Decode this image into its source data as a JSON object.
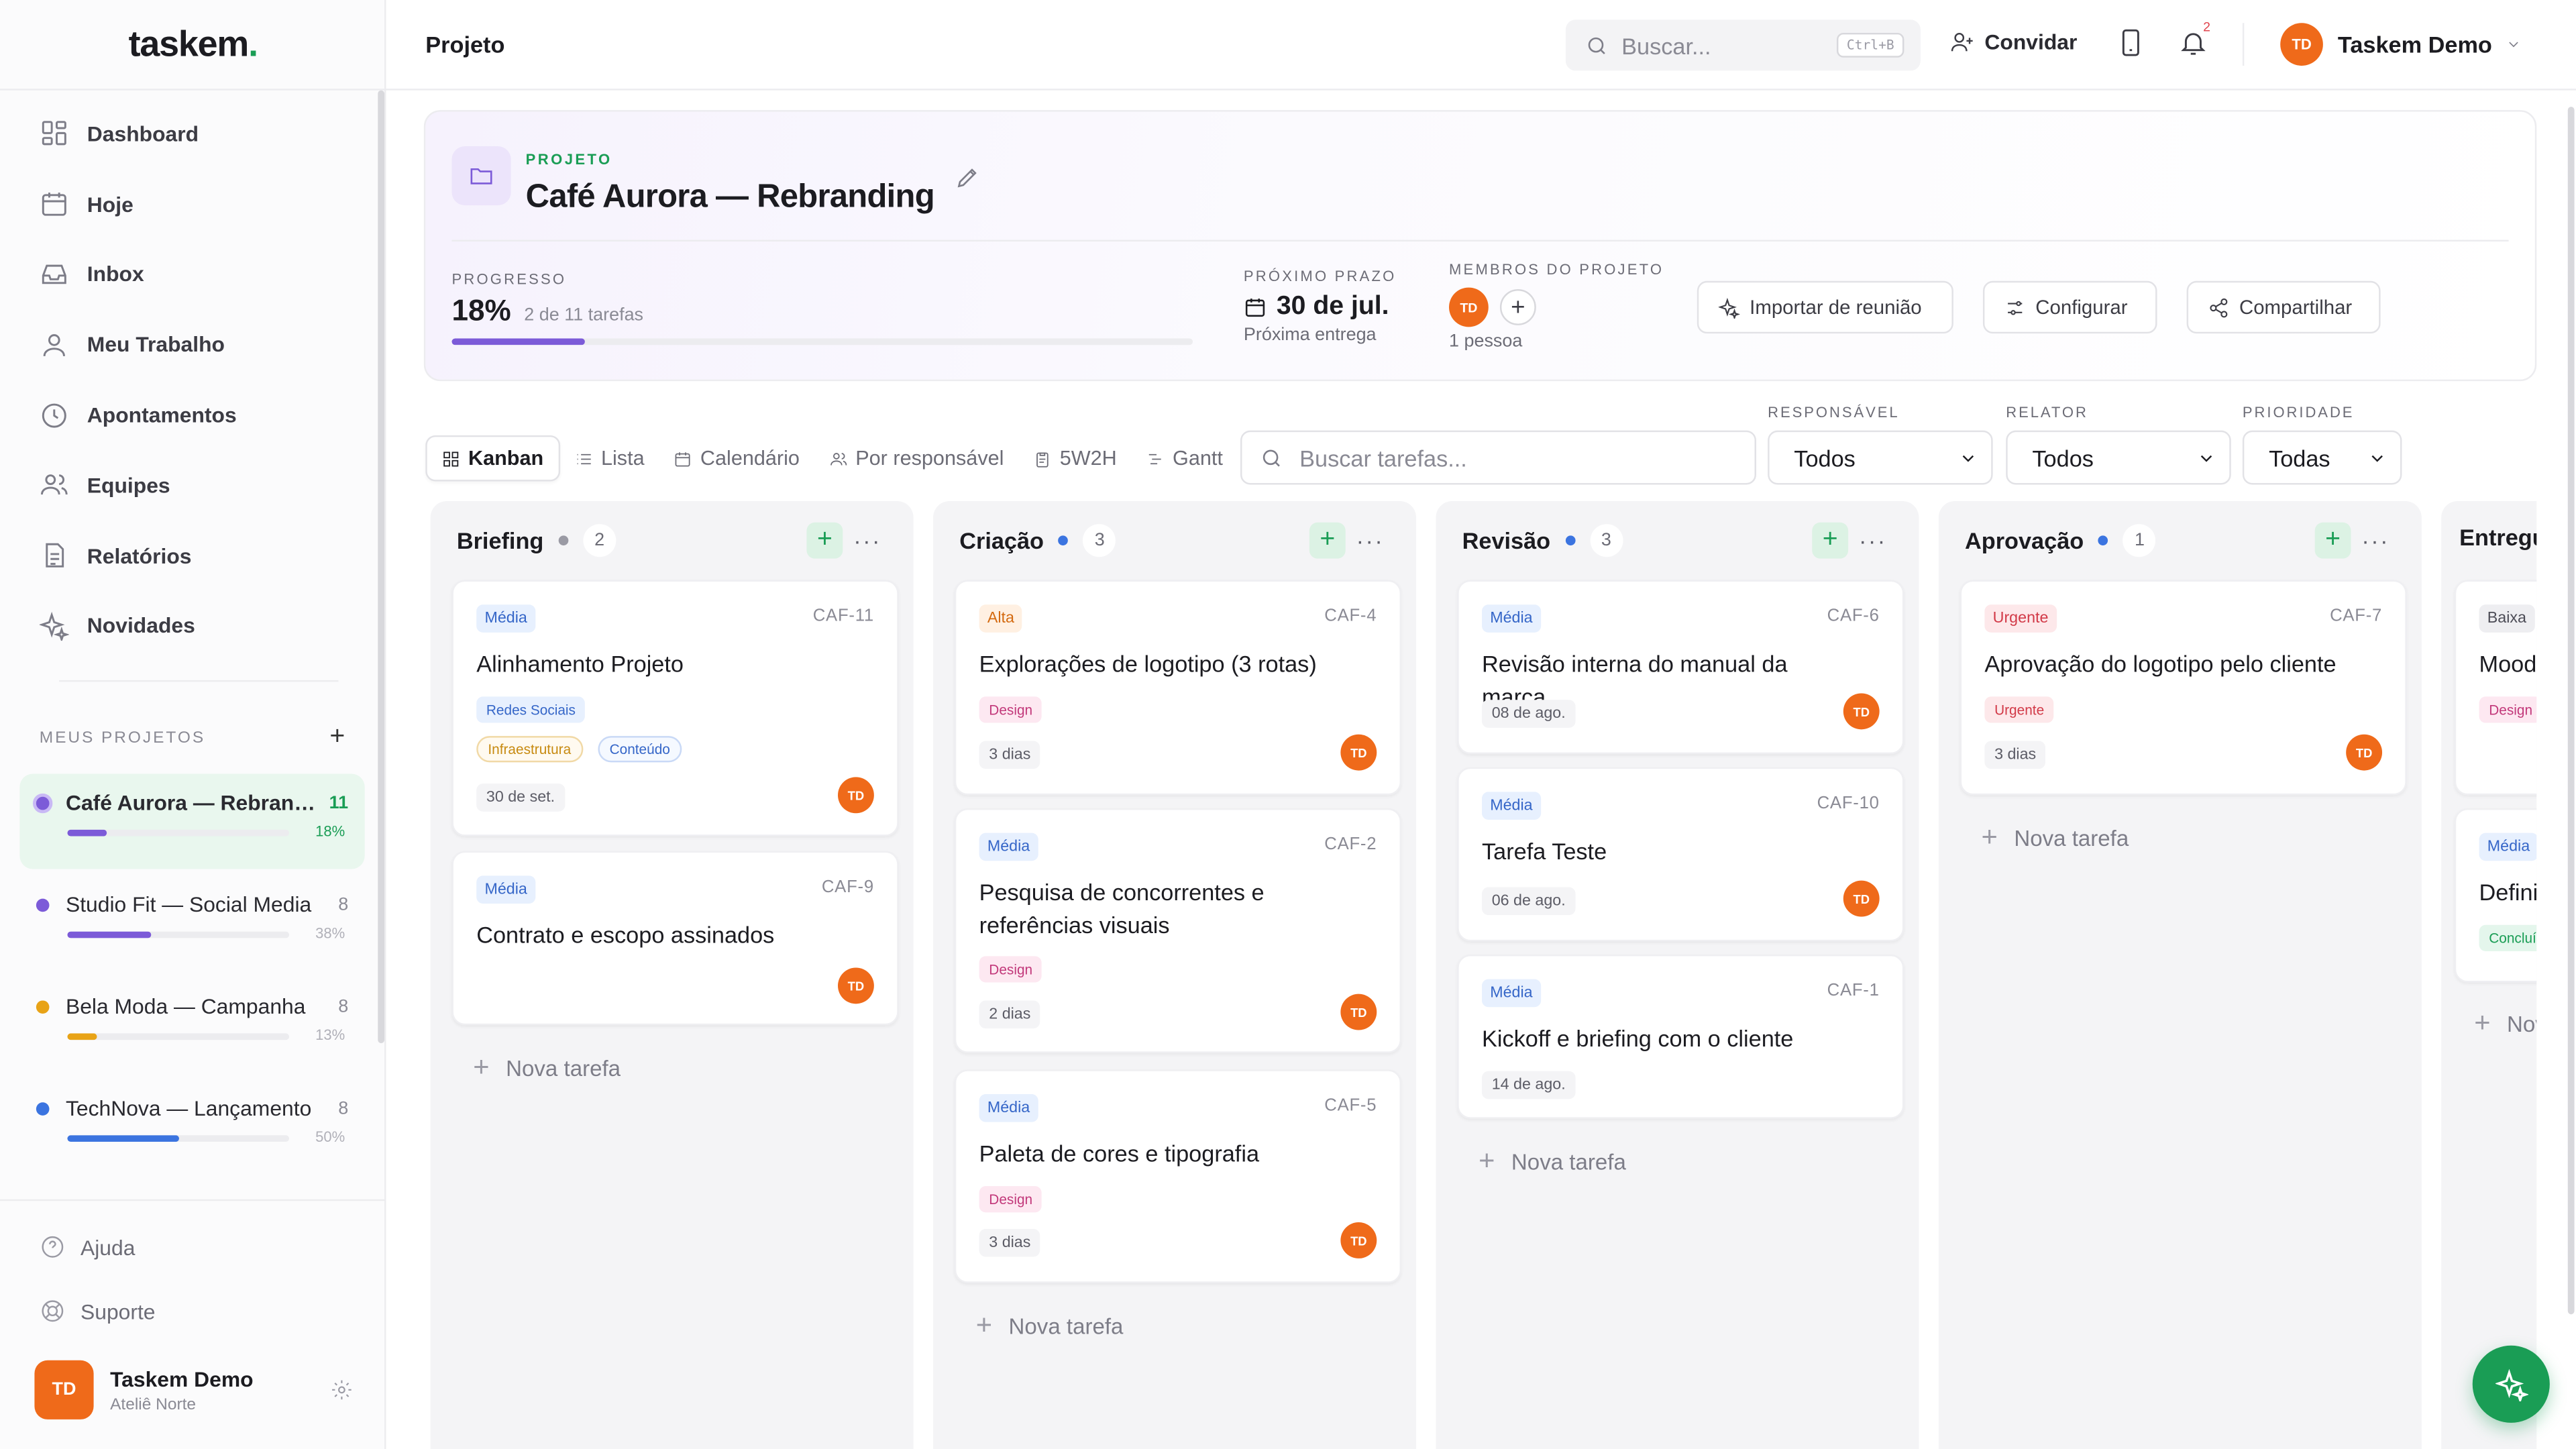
{
  "sidebar": {
    "logo": "taskem",
    "logo_dot": ".",
    "nav": [
      {
        "label": "Dashboard",
        "icon": "dashboard-icon"
      },
      {
        "label": "Hoje",
        "icon": "calendar-icon"
      },
      {
        "label": "Inbox",
        "icon": "inbox-icon"
      },
      {
        "label": "Meu Trabalho",
        "icon": "user-icon"
      },
      {
        "label": "Apontamentos",
        "icon": "clock-icon"
      },
      {
        "label": "Equipes",
        "icon": "team-icon"
      },
      {
        "label": "Relatórios",
        "icon": "report-icon"
      },
      {
        "label": "Novidades",
        "icon": "sparkles-icon"
      }
    ],
    "projects_heading": "MEUS PROJETOS",
    "projects_add": "+",
    "projects": [
      {
        "name": "Café Aurora — Rebranding",
        "count": "11",
        "progress_pct": "18%",
        "progress": 18,
        "color": "#7c5bd8"
      },
      {
        "name": "Studio Fit — Social Media",
        "count": "8",
        "progress_pct": "38%",
        "progress": 38,
        "color": "#7c5bd8"
      },
      {
        "name": "Bela Moda — Campanha",
        "count": "8",
        "progress_pct": "13%",
        "progress": 13,
        "color": "#e8a317"
      },
      {
        "name": "TechNova — Lançamento",
        "count": "8",
        "progress_pct": "50%",
        "progress": 50,
        "color": "#3b74e0"
      }
    ],
    "help": "Ajuda",
    "support": "Suporte",
    "user": {
      "initials": "TD",
      "name": "Taskem Demo",
      "org": "Ateliê Norte"
    }
  },
  "topbar": {
    "title": "Projeto",
    "search_placeholder": "Buscar...",
    "search_shortcut": "Ctrl+B",
    "invite": "Convidar",
    "notifications_count": "2",
    "user_initials": "TD",
    "user_name": "Taskem Demo"
  },
  "project": {
    "eyebrow": "PROJETO",
    "title": "Café Aurora — Rebranding",
    "progress_label": "PROGRESSO",
    "progress_value": "18%",
    "progress_fraction": 0.18,
    "progress_sub": "2 de 11 tarefas",
    "deadline_label": "PRÓXIMO PRAZO",
    "deadline": "30 de jul.",
    "deadline_sub": "Próxima entrega",
    "members_label": "MEMBROS DO PROJETO",
    "member_initials": "TD",
    "member_add": "+",
    "members_sub": "1 pessoa",
    "actions": {
      "import": "Importar de reunião",
      "configure": "Configurar",
      "share": "Compartilhar"
    }
  },
  "toolbar": {
    "views": [
      "Kanban",
      "Lista",
      "Calendário",
      "Por responsável",
      "5W2H",
      "Gantt"
    ],
    "task_search_placeholder": "Buscar tarefas...",
    "filters": [
      {
        "label": "RESPONSÁVEL",
        "value": "Todos"
      },
      {
        "label": "RELATOR",
        "value": "Todos"
      },
      {
        "label": "PRIORIDADE",
        "value": "Todas"
      }
    ]
  },
  "board": {
    "new_task": "Nova tarefa",
    "columns": [
      {
        "name": "Briefing",
        "count": "2",
        "dot": "#9a9aa4"
      },
      {
        "name": "Criação",
        "count": "3",
        "dot": "#3b74e0"
      },
      {
        "name": "Revisão",
        "count": "3",
        "dot": "#3b74e0"
      },
      {
        "name": "Aprovação",
        "count": "1",
        "dot": "#3b74e0"
      },
      {
        "name": "Entregue",
        "count": "",
        "dot": "#1a9d55"
      }
    ],
    "cards": {
      "caf11": {
        "priority": "Média",
        "id": "CAF-11",
        "title": "Alinhamento Projeto",
        "tags": [
          "Redes Sociais",
          "Infraestrutura",
          "Conteúdo"
        ],
        "date": "30 de set.",
        "assignee": "TD"
      },
      "caf9": {
        "priority": "Média",
        "id": "CAF-9",
        "title": "Contrato e escopo assinados",
        "assignee": "TD"
      },
      "caf4": {
        "priority": "Alta",
        "id": "CAF-4",
        "title": "Explorações de logotipo (3 rotas)",
        "tags": [
          "Design"
        ],
        "date": "3 dias",
        "assignee": "TD"
      },
      "caf2": {
        "priority": "Média",
        "id": "CAF-2",
        "title": "Pesquisa de concorrentes e referências visuais",
        "tags": [
          "Design"
        ],
        "date": "2 dias",
        "assignee": "TD"
      },
      "caf5": {
        "priority": "Média",
        "id": "CAF-5",
        "title": "Paleta de cores e tipografia",
        "tags": [
          "Design"
        ],
        "date": "3 dias",
        "assignee": "TD"
      },
      "caf6": {
        "priority": "Média",
        "id": "CAF-6",
        "title": "Revisão interna do manual da marca",
        "date": "08 de ago.",
        "assignee": "TD"
      },
      "caf10": {
        "priority": "Média",
        "id": "CAF-10",
        "title": "Tarefa Teste",
        "date": "06 de ago.",
        "assignee": "TD"
      },
      "caf1": {
        "priority": "Média",
        "id": "CAF-1",
        "title": "Kickoff e briefing com o cliente",
        "date": "14 de ago."
      },
      "caf7": {
        "priority": "Urgente",
        "id": "CAF-7",
        "title": "Aprovação do logotipo pelo cliente",
        "tags": [
          "Urgente"
        ],
        "date": "3 dias",
        "assignee": "TD"
      },
      "e1": {
        "priority": "Baixa",
        "title": "Moodboard",
        "tags": [
          "Design"
        ]
      },
      "e2": {
        "priority": "Média",
        "title": "Definição",
        "tags": [
          "Concluída"
        ]
      }
    }
  }
}
